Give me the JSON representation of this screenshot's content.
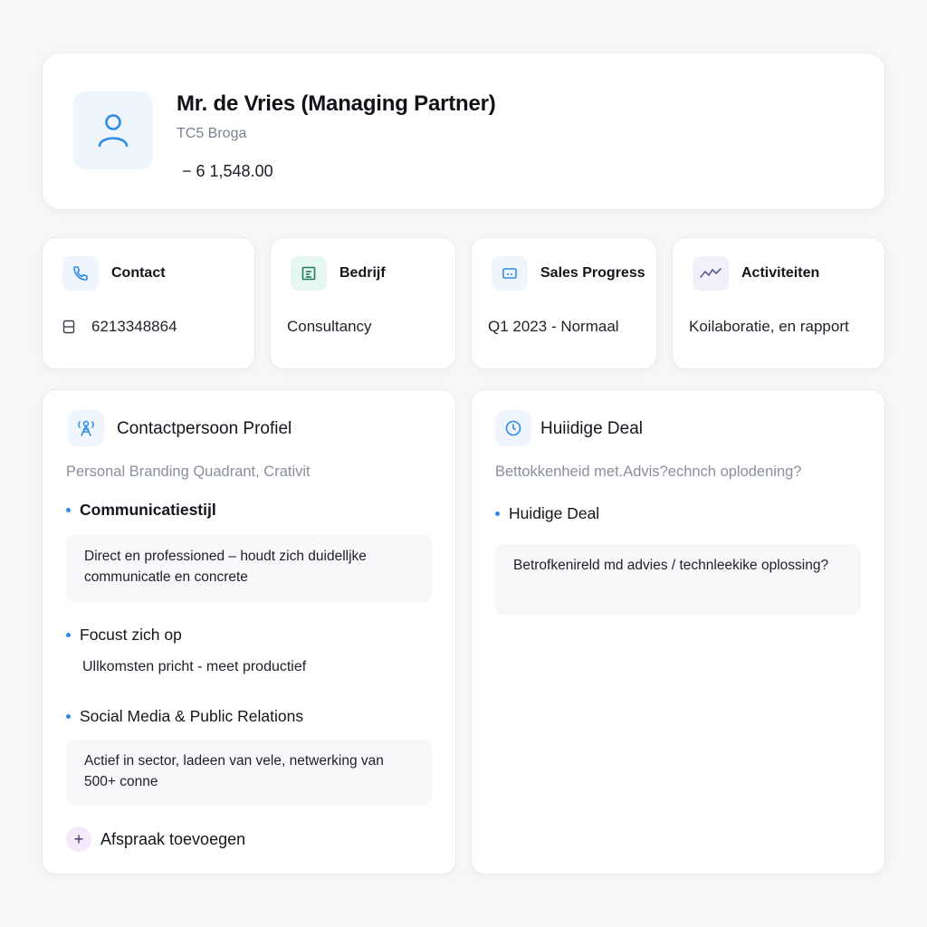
{
  "profile": {
    "name": "Mr. de Vries (Managing Partner)",
    "company": "TC5 Broga",
    "amount": "− 6 1,548.00"
  },
  "info_cards": [
    {
      "title": "Contact",
      "value": "6213348864",
      "icon": "phone-icon",
      "icon_bg": "#eef5fd"
    },
    {
      "title": "Bedrijf",
      "value": "Consultancy",
      "icon": "document-icon",
      "icon_bg": "#e6f7f1"
    },
    {
      "title": "Sales Progress",
      "value": "Q1 2023 - Normaal",
      "icon": "card-icon",
      "icon_bg": "#eef5fd"
    },
    {
      "title": "Activiteiten",
      "value": "Koilaboratie, en rapport",
      "icon": "activity-icon",
      "icon_bg": "#f1f0fa"
    }
  ],
  "contact_profile": {
    "title": "Contactpersoon Profiel",
    "subtitle": "Personal Branding Quadrant, Crativit",
    "sections": [
      {
        "heading": "Communicatiestijl",
        "text": "Direct en professioned – houdt zich duidelljke communicatle en concrete"
      },
      {
        "heading": "Focust zich op",
        "text": "Ullkomsten pricht - meet productief"
      },
      {
        "heading": "Social Media & Public Relations",
        "text": "Actief in sector, ladeen van vele, netwerking van 500+ conne"
      }
    ],
    "add_label": "Afspraak toevoegen"
  },
  "current_deal": {
    "title": "Huiidige Deal",
    "subtitle": "Bettokkenheid met.Advis?echnch oplodening?",
    "heading": "Huidige Deal",
    "text": "Betrofkenireld md advies / technleekike oplossing?"
  },
  "colors": {
    "accent": "#2f8be6",
    "background": "#f7f7f8"
  }
}
